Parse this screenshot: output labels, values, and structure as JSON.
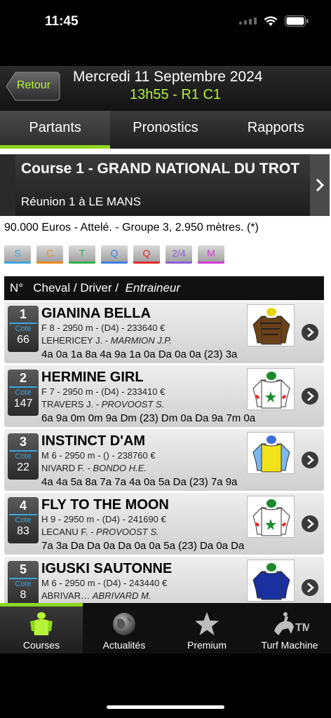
{
  "status": {
    "time": "11:45"
  },
  "header": {
    "back_label": "Retour",
    "date": "Mercredi 11 Septembre 2024",
    "race_code": "13h55 - R1 C1"
  },
  "tabs": [
    {
      "label": "Partants",
      "active": true
    },
    {
      "label": "Pronostics",
      "active": false
    },
    {
      "label": "Rapports",
      "active": false
    }
  ],
  "course": {
    "title": "Course 1 - GRAND NATIONAL DU TROT",
    "reunion": "Réunion 1 à LE MANS",
    "info": "90.000 Euros - Attelé. - Groupe 3, 2.950 mètres. (*)"
  },
  "bets": [
    {
      "label": "S",
      "color": "#3aa6e0"
    },
    {
      "label": "C",
      "color": "#f08a1c"
    },
    {
      "label": "T",
      "color": "#2fb34a"
    },
    {
      "label": "Q",
      "color": "#3a7fe0"
    },
    {
      "label": "Q",
      "color": "#e02a2a"
    },
    {
      "label": "2/4",
      "color": "#8a5fd6"
    },
    {
      "label": "M",
      "color": "#d63ad6"
    }
  ],
  "table_head": {
    "n": "N°",
    "cheval": "Cheval / Driver /",
    "entraineur": "Entraineur"
  },
  "runners": [
    {
      "num": "1",
      "cote_label": "Cote",
      "cote": "66",
      "name": "GIANINA BELLA",
      "meta": "F 8 - 2950 m - (D4) - 233640 €",
      "driver": "LEHERICEY J. -",
      "trainer": "MARMION J.P.",
      "perf": "4a 0a 1a 8a 4a 9a 1a 0a Da 0a 0a (23) 3a",
      "silk": "brown"
    },
    {
      "num": "2",
      "cote_label": "Cote",
      "cote": "147",
      "name": "HERMINE GIRL",
      "meta": "F 7 - 2950 m - (D4) - 233410 €",
      "driver": "TRAVERS J. -",
      "trainer": "PROVOOST S.",
      "perf": "6a 9a 0m 0m 9a Dm (23) Dm 0a Da 9a 7m 0a",
      "silk": "white-star"
    },
    {
      "num": "3",
      "cote_label": "Cote",
      "cote": "22",
      "name": "INSTINCT D'AM",
      "meta": "M 6 - 2950 m - () - 238760 €",
      "driver": "NIVARD F. -",
      "trainer": "BONDO H.E.",
      "perf": "4a 4a 5a 8a 7a 7a 4a 0a 5a Da (23) 7a 9a",
      "silk": "yellow"
    },
    {
      "num": "4",
      "cote_label": "Cote",
      "cote": "83",
      "name": "FLY TO THE MOON",
      "meta": "H 9 - 2950 m - (D4) - 241690 €",
      "driver": "LECANU F. -",
      "trainer": "PROVOOST S.",
      "perf": "7a 3a Da Da 0a Da 0a 0a 5a (23) Da 0a Da",
      "silk": "white-star"
    },
    {
      "num": "5",
      "cote_label": "Cote",
      "cote": "8",
      "name": "IGUSKI SAUTONNE",
      "meta": "M 6 - 2950 m - (D4) - 243440 €",
      "driver": "ABRIVAR…",
      "trainer": "ABRIVARD M.",
      "perf": "",
      "silk": "blue"
    }
  ],
  "bottom_nav": [
    {
      "label": "Courses",
      "icon": "jockey-icon",
      "active": true
    },
    {
      "label": "Actualités",
      "icon": "globe-icon",
      "active": false
    },
    {
      "label": "Premium",
      "icon": "star-icon",
      "active": false
    },
    {
      "label": "Turf Machine",
      "icon": "horse-rider-icon",
      "active": false
    }
  ]
}
